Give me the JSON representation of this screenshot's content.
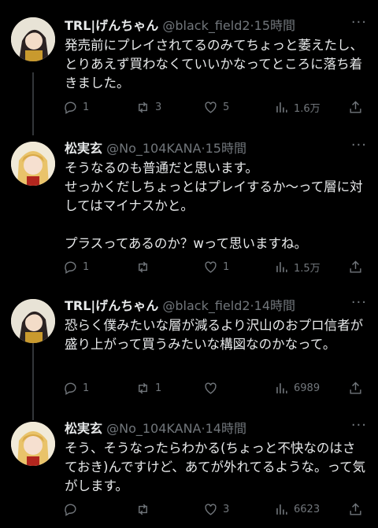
{
  "tweets": [
    {
      "name": "TRL|げんちゃん",
      "handle": "@black_field2",
      "time": "15時間",
      "body": "発売前にプレイされてるのみてちょっと萎えたし、とりあえず買わなくていいかなってところに落ち着きました。",
      "replies": "1",
      "retweets": "3",
      "likes": "5",
      "views": "1.6万"
    },
    {
      "name": "松実玄",
      "handle": "@No_104KANA",
      "time": "15時間",
      "body": "そうなるのも普通だと思います。\nせっかくだしちょっとはプレイするか〜って層に対してはマイナスかと。\n\nプラスってあるのか？wって思いますね。",
      "replies": "1",
      "retweets": "",
      "likes": "1",
      "views": "1.5万"
    },
    {
      "name": "TRL|げんちゃん",
      "handle": "@black_field2",
      "time": "14時間",
      "body": "恐らく僕みたいな層が減るより沢山のおプロ信者が盛り上がって買うみたいな構図なのかなって。",
      "replies": "1",
      "retweets": "1",
      "likes": "",
      "views": "6989"
    },
    {
      "name": "松実玄",
      "handle": "@No_104KANA",
      "time": "14時間",
      "body": "そう、そうなったらわかる(ちょっと不快なのはさておき)んですけど、あてが外れてるような。って気がします。",
      "replies": "",
      "retweets": "",
      "likes": "3",
      "views": "6623"
    }
  ],
  "colors": {
    "bg": "#000000",
    "text": "#e7e9ea",
    "muted": "#71767b",
    "line": "#333639"
  }
}
